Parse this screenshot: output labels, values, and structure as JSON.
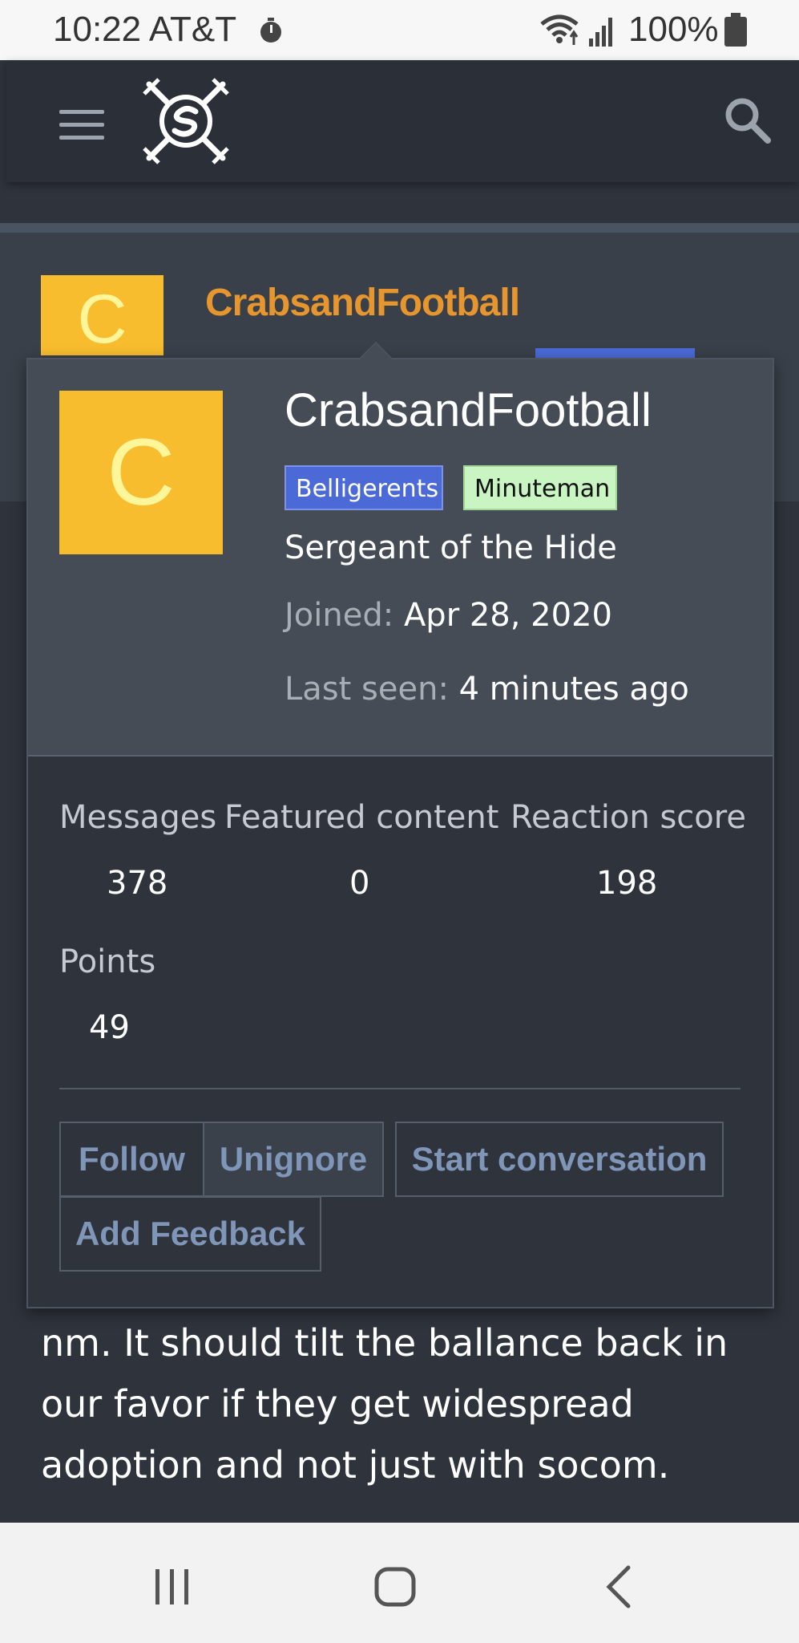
{
  "status_bar": {
    "time": "10:22 AT&T",
    "battery": "100%",
    "icons": [
      "stopwatch-icon",
      "wifi-icon",
      "signal-icon",
      "battery-icon"
    ]
  },
  "header": {
    "icons": [
      "menu-icon",
      "site-logo",
      "search-icon"
    ]
  },
  "background_profile": {
    "avatar_letter": "C",
    "username": "CrabsandFootball"
  },
  "popup": {
    "avatar_letter": "C",
    "username": "CrabsandFootball",
    "badges": [
      "Belligerents",
      "Minuteman"
    ],
    "title": "Sergeant of the Hide",
    "joined_label": "Joined:",
    "joined_value": "Apr 28, 2020",
    "last_seen_label": "Last seen:",
    "last_seen_value": "4 minutes ago",
    "stats": {
      "messages_label": "Messages",
      "messages_value": "378",
      "featured_label": "Featured content",
      "featured_value": "0",
      "reaction_label": "Reaction score",
      "reaction_value": "198",
      "points_label": "Points",
      "points_value": "49"
    },
    "buttons": {
      "follow": "Follow",
      "unignore": "Unignore",
      "start_conversation": "Start conversation",
      "add_feedback": "Add Feedback"
    }
  },
  "post_text": {
    "line1": "nm. It should tilt the ballance back in",
    "line2": "our favor if they get widespread",
    "line3": "adoption and not just with socom."
  },
  "colors": {
    "accent_username": "#e7962e",
    "avatar_bg": "#f7bd2e",
    "badge_blue": "#4b6ad7",
    "badge_green": "#c9f5c3",
    "button_text": "#7f96b8"
  },
  "nav_bar": {
    "icons": [
      "recent-apps-icon",
      "home-icon",
      "back-icon"
    ]
  }
}
